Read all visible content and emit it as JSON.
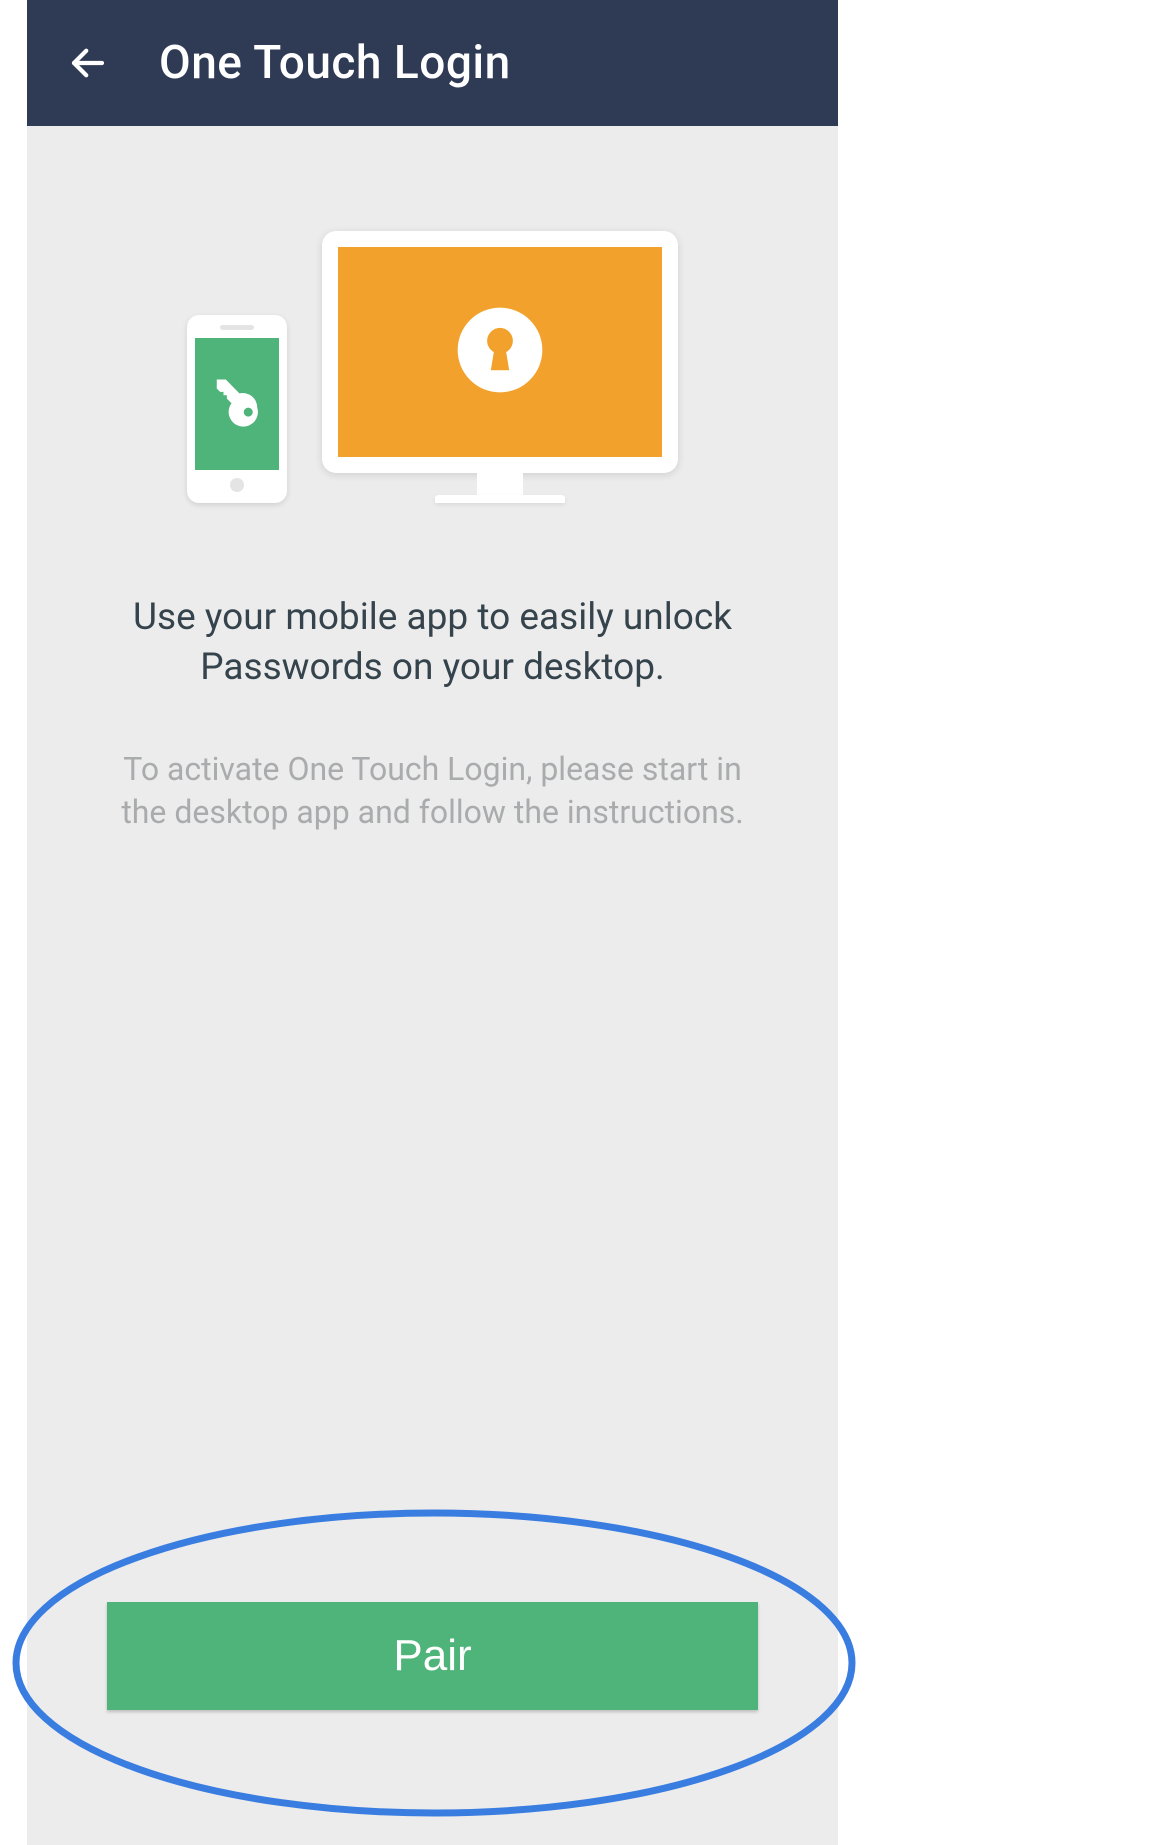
{
  "header": {
    "title": "One Touch Login"
  },
  "illustration": {
    "phone_icon": "key-icon",
    "monitor_icon": "keyhole-icon"
  },
  "main": {
    "headline": "Use your mobile app to easily unlock Passwords on your desktop.",
    "subtext": "To activate One Touch Login, please start in the desktop app and follow the instructions."
  },
  "actions": {
    "pair_label": "Pair"
  },
  "colors": {
    "header_bg": "#2f3a55",
    "accent_green": "#4fb479",
    "accent_orange": "#f2a22c",
    "highlight_blue": "#3a7de0"
  }
}
